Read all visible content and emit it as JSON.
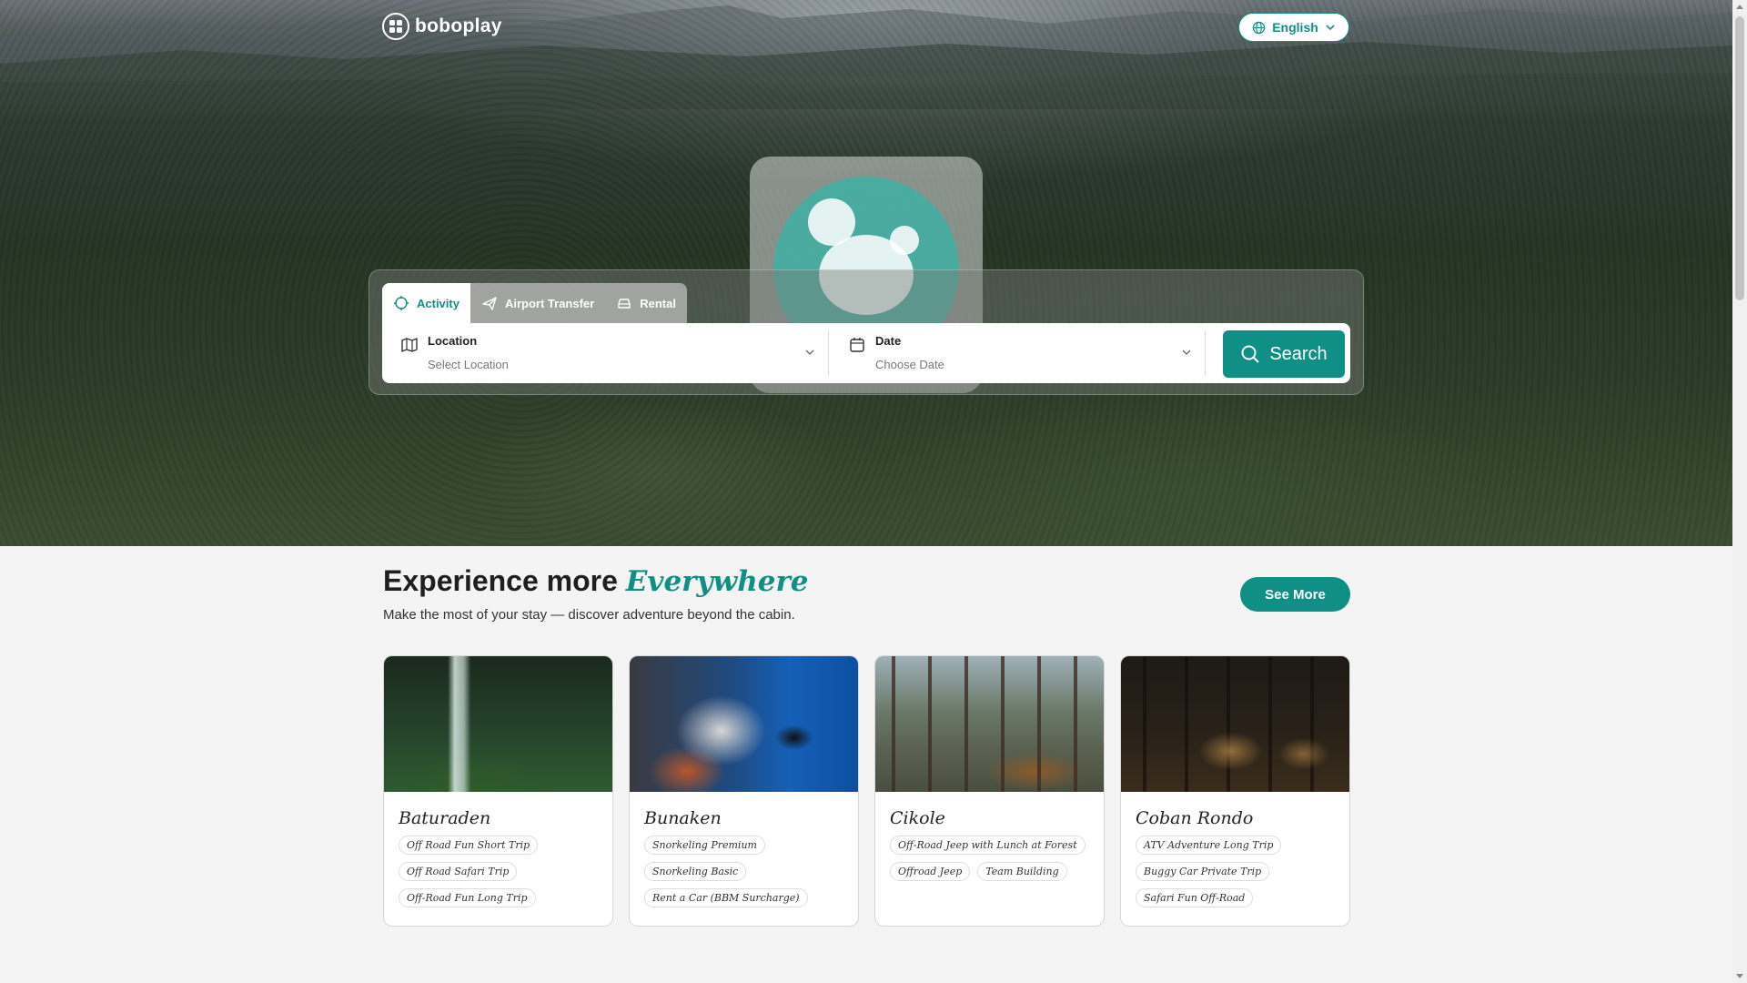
{
  "header": {
    "logo_text": "boboplay",
    "language": "English"
  },
  "search": {
    "tabs": [
      {
        "label": "Activity",
        "icon": "activity-icon",
        "active": true
      },
      {
        "label": "Airport Transfer",
        "icon": "plane-icon",
        "active": false
      },
      {
        "label": "Rental",
        "icon": "car-icon",
        "active": false
      }
    ],
    "location_label": "Location",
    "location_placeholder": "Select Location",
    "date_label": "Date",
    "date_placeholder": "Choose Date",
    "search_label": "Search"
  },
  "section": {
    "heading": "Experience more",
    "heading_accent": "Everywhere",
    "subtitle": "Make the most of your stay — discover adventure beyond the cabin.",
    "see_more": "See More"
  },
  "destinations": [
    {
      "name": "Baturaden",
      "tags": [
        "Off Road Fun Short Trip",
        "Off Road Safari Trip",
        "Off-Road Fun Long Trip"
      ]
    },
    {
      "name": "Bunaken",
      "tags": [
        "Snorkeling Premium",
        "Snorkeling Basic",
        "Rent a Car (BBM Surcharge)"
      ]
    },
    {
      "name": "Cikole",
      "tags": [
        "Off-Road Jeep with Lunch at Forest",
        "Offroad Jeep",
        "Team Building"
      ]
    },
    {
      "name": "Coban Rondo",
      "tags": [
        "ATV Adventure Long Trip",
        "Buggy Car Private Trip",
        "Safari Fun Off-Road"
      ]
    }
  ],
  "colors": {
    "accent": "#0f8f86",
    "page_bg": "#f4f4f4"
  }
}
